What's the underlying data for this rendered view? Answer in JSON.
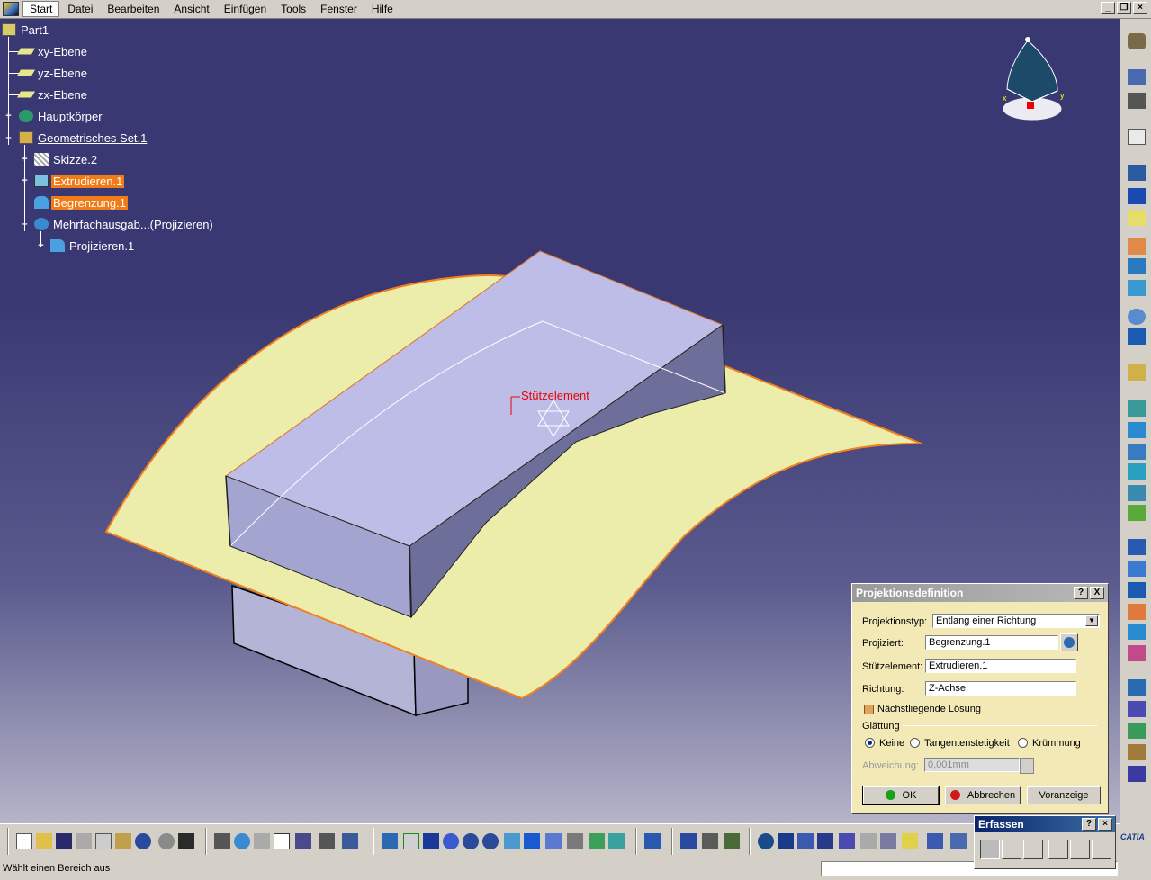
{
  "menu": {
    "items": [
      "Start",
      "Datei",
      "Bearbeiten",
      "Ansicht",
      "Einfügen",
      "Tools",
      "Fenster",
      "Hilfe"
    ]
  },
  "tree": {
    "root": "Part1",
    "xy": "xy-Ebene",
    "yz": "yz-Ebene",
    "zx": "zx-Ebene",
    "body": "Hauptkörper",
    "geoset": "Geometrisches Set.1",
    "sketch": "Skizze.2",
    "extrude": "Extrudieren.1",
    "boundary": "Begrenzung.1",
    "multi": "Mehrfachausgab...(Projizieren)",
    "project": "Projizieren.1"
  },
  "scene": {
    "support_label": "Stützelement"
  },
  "dialog": {
    "title": "Projektionsdefinition",
    "type_label": "Projektionstyp:",
    "type_value": "Entlang einer Richtung",
    "projected_label": "Projiziert:",
    "projected_value": "Begrenzung.1",
    "support_label": "Stützelement:",
    "support_value": "Extrudieren.1",
    "direction_label": "Richtung:",
    "direction_value": "Z-Achse:",
    "nearest_label": "Nächstliegende Lösung",
    "smoothing_label": "Glättung",
    "opt_none": "Keine",
    "opt_tangent": "Tangentenstetigkeit",
    "opt_curvature": "Krümmung",
    "deviation_label": "Abweichung:",
    "deviation_value": "0,001mm",
    "ok": "OK",
    "cancel": "Abbrechen",
    "preview": "Voranzeige",
    "help_btn": "?",
    "close_btn": "X"
  },
  "erfassen": {
    "title": "Erfassen"
  },
  "status": {
    "text": "Wählt einen Bereich aus"
  },
  "logo": {
    "text": "CATIA"
  },
  "colors": {
    "background_top": "#3a3872",
    "surface_fill": "#ecedaa",
    "surface_edge": "#f08020",
    "box_fill": "#b8b8e4",
    "selection": "#f07b17",
    "dialog_bg": "#f3e9b6"
  }
}
